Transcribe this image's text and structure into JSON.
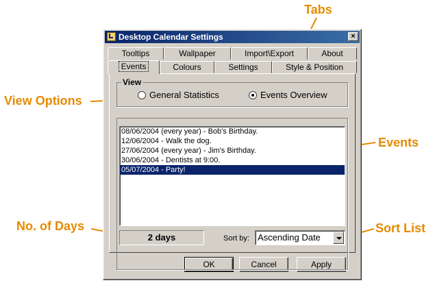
{
  "annotations": {
    "tabs": "Tabs",
    "view_options": "View Options",
    "events": "Events",
    "no_of_days": "No. of Days",
    "sort_list": "Sort List"
  },
  "window": {
    "title": "Desktop Calendar Settings",
    "close_label": "×"
  },
  "tabs_row_back": [
    {
      "label": "Tooltips"
    },
    {
      "label": "Wallpaper"
    },
    {
      "label": "Import\\Export"
    },
    {
      "label": "About"
    }
  ],
  "tabs_row_front": [
    {
      "label": "Events",
      "active": true
    },
    {
      "label": "Colours"
    },
    {
      "label": "Settings"
    },
    {
      "label": "Style & Position"
    }
  ],
  "view": {
    "legend": "View",
    "options": [
      {
        "label": "General Statistics",
        "selected": false
      },
      {
        "label": "Events Overview",
        "selected": true
      }
    ]
  },
  "events_list": {
    "items": [
      "08/06/2004 (every year)  -  Bob's Birthday.",
      "12/06/2004  -  Walk the dog.",
      "27/06/2004 (every year)  -  Jim's Birthday.",
      "30/06/2004  -  Dentists at 9:00.",
      "05/07/2004  -  Party!"
    ],
    "selected_index": 4
  },
  "days": {
    "value": "2 days"
  },
  "sort": {
    "label": "Sort by:",
    "value": "Ascending Date"
  },
  "buttons": {
    "ok": "OK",
    "cancel": "Cancel",
    "apply": "Apply"
  },
  "colors": {
    "annotation": "#e68a00",
    "title_bar": "#0a246a",
    "selection": "#0a246a",
    "face": "#d4d0c8"
  }
}
